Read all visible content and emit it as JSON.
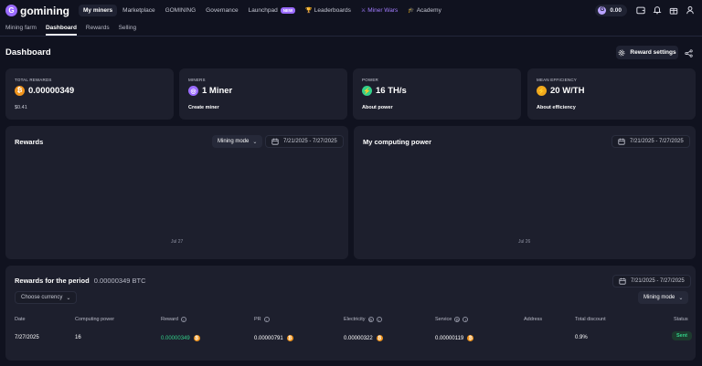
{
  "brand": {
    "name": "gomining",
    "logo_letter": "G"
  },
  "nav": {
    "items": [
      {
        "label": "My miners",
        "active": true
      },
      {
        "label": "Marketplace"
      },
      {
        "label": "GOMINING"
      },
      {
        "label": "Governance"
      },
      {
        "label": "Launchpad",
        "badge": "NEW"
      },
      {
        "label": "Leaderboards",
        "icon": "trophy-icon"
      },
      {
        "label": "Miner Wars",
        "icon": "swords-icon",
        "accent": "#a27cff"
      },
      {
        "label": "Academy",
        "icon": "academy-icon"
      }
    ],
    "balance": {
      "currency_letter": "G",
      "value": "0.00"
    }
  },
  "subnav": {
    "tabs": [
      {
        "label": "Mining farm"
      },
      {
        "label": "Dashboard",
        "active": true
      },
      {
        "label": "Rewards"
      },
      {
        "label": "Selling"
      }
    ]
  },
  "page": {
    "title": "Dashboard",
    "reward_settings_label": "Reward settings"
  },
  "stats": [
    {
      "label": "TOTAL REWARDS",
      "value": "0.00000349",
      "footer": "$0.41",
      "icon": "bitcoin-icon",
      "color": "#f0941d"
    },
    {
      "label": "MINERS",
      "value": "1 Miner",
      "footer": "Create miner",
      "icon": "miner-icon",
      "color": "#9a6bff"
    },
    {
      "label": "POWER",
      "value": "16 TH/s",
      "footer": "About power",
      "icon": "lightning-icon",
      "color": "#33d18a"
    },
    {
      "label": "MEAN EFFICIENCY",
      "value": "20 W/TH",
      "footer": "About efficiency",
      "icon": "efficiency-icon",
      "color": "#f0a81d"
    }
  ],
  "rewards_chart": {
    "title": "Rewards",
    "mode_label": "Mining mode",
    "date_range": "7/21/2025 - 7/27/2025",
    "x_label": "Jul 27"
  },
  "power_chart": {
    "title": "My computing power",
    "date_range": "7/21/2025 - 7/27/2025",
    "x_label": "Jul 26"
  },
  "rewards_table": {
    "title": "Rewards for the period",
    "amount": "0.00000349 BTC",
    "currency_placeholder": "Choose currency",
    "date_range": "7/21/2025 - 7/27/2025",
    "mode_label": "Mining mode",
    "headers": {
      "date": "Date",
      "computing_power": "Computing power",
      "reward": "Reward",
      "pr": "PR",
      "electricity": "Electricity",
      "service": "Service",
      "address": "Address",
      "total_discount": "Total discount",
      "status": "Status"
    },
    "rows": [
      {
        "date": "7/27/2025",
        "computing_power": "16",
        "reward": "0.00000349",
        "pr": "0.00000791",
        "electricity": "0.00000322",
        "service": "0.00000119",
        "address": "",
        "total_discount": "0.9%",
        "status": "Sent"
      }
    ]
  }
}
